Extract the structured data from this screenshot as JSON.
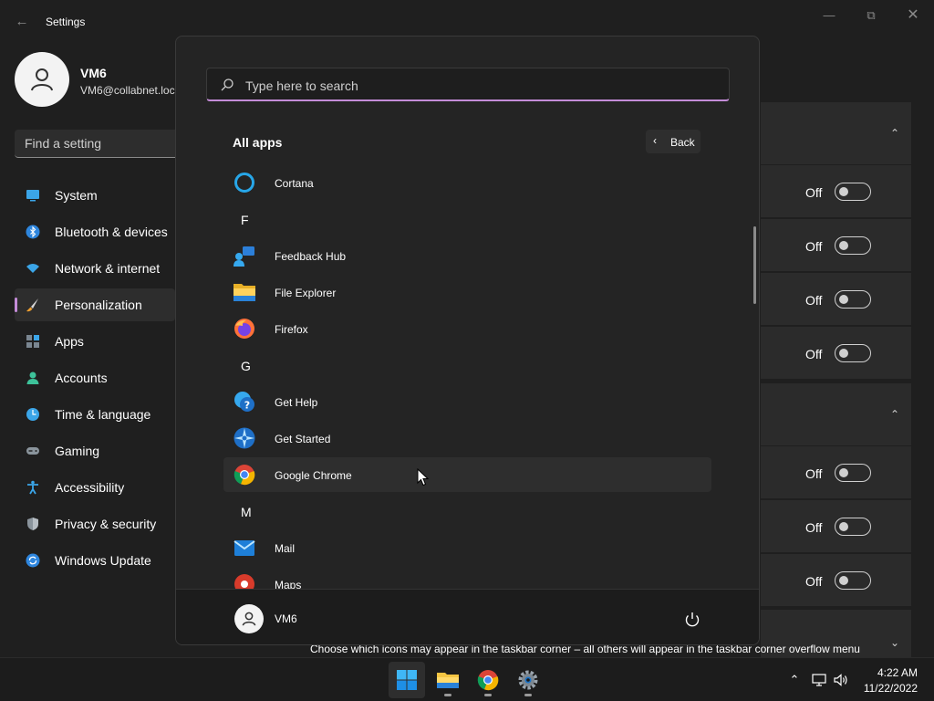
{
  "settings": {
    "title": "Settings",
    "user": {
      "name": "VM6",
      "email": "VM6@collabnet.loc"
    },
    "search_placeholder": "Find a setting",
    "nav": [
      {
        "label": "System",
        "icon": "monitor-icon"
      },
      {
        "label": "Bluetooth & devices",
        "icon": "bluetooth-icon"
      },
      {
        "label": "Network & internet",
        "icon": "wifi-icon"
      },
      {
        "label": "Personalization",
        "icon": "brush-icon",
        "active": true
      },
      {
        "label": "Apps",
        "icon": "apps-icon"
      },
      {
        "label": "Accounts",
        "icon": "person-icon"
      },
      {
        "label": "Time & language",
        "icon": "clock-globe-icon"
      },
      {
        "label": "Gaming",
        "icon": "gamepad-icon"
      },
      {
        "label": "Accessibility",
        "icon": "accessibility-icon"
      },
      {
        "label": "Privacy & security",
        "icon": "shield-icon"
      },
      {
        "label": "Windows Update",
        "icon": "update-icon"
      }
    ],
    "toggle_label": "Off",
    "taskbar_corner_description": "Choose which icons may appear in the taskbar corner – all others will appear in the taskbar corner overflow menu"
  },
  "start_menu": {
    "search_placeholder": "Type here to search",
    "all_apps_title": "All apps",
    "back_label": "Back",
    "apps": [
      {
        "kind": "app",
        "name": "Cortana",
        "icon": "cortana-icon"
      },
      {
        "kind": "letter",
        "name": "F"
      },
      {
        "kind": "app",
        "name": "Feedback Hub",
        "icon": "feedback-hub-icon"
      },
      {
        "kind": "app",
        "name": "File Explorer",
        "icon": "folder-icon"
      },
      {
        "kind": "app",
        "name": "Firefox",
        "icon": "firefox-icon"
      },
      {
        "kind": "letter",
        "name": "G"
      },
      {
        "kind": "app",
        "name": "Get Help",
        "icon": "get-help-icon"
      },
      {
        "kind": "app",
        "name": "Get Started",
        "icon": "get-started-icon"
      },
      {
        "kind": "app",
        "name": "Google Chrome",
        "icon": "chrome-icon",
        "hovered": true
      },
      {
        "kind": "letter",
        "name": "M"
      },
      {
        "kind": "app",
        "name": "Mail",
        "icon": "mail-icon"
      },
      {
        "kind": "app",
        "name": "Maps",
        "icon": "maps-icon"
      }
    ],
    "footer_user": "VM6"
  },
  "taskbar": {
    "pinned": [
      "windows-start-icon",
      "file-explorer-icon",
      "chrome-icon",
      "settings-gear-icon"
    ],
    "time": "4:22 AM",
    "date": "11/22/2022"
  },
  "colors": {
    "accent": "#c48cd8",
    "menu_bg": "#242424",
    "window_bg": "#1f1f1f"
  }
}
